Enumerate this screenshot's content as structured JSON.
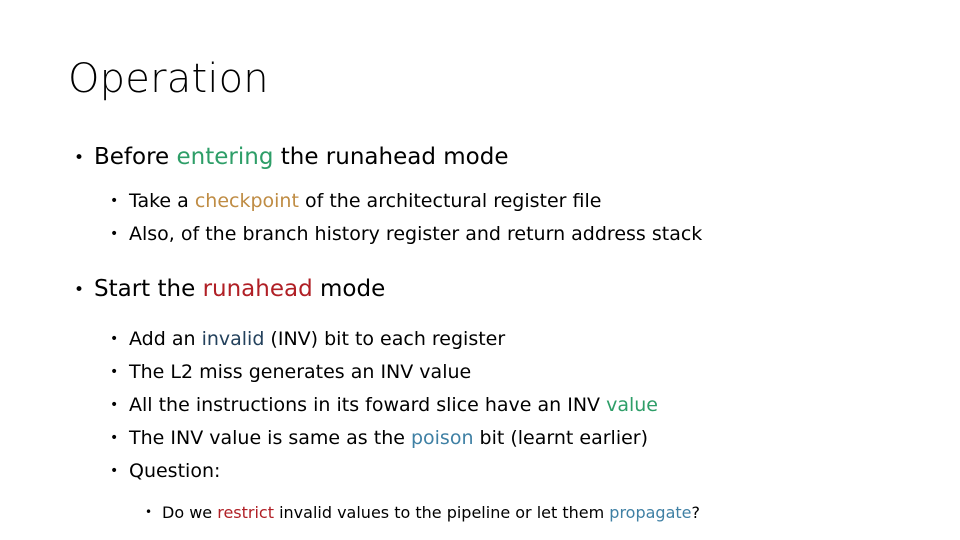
{
  "slide": {
    "title": "Operation",
    "bullet_glyph": "•",
    "colors": {
      "green": "#2e9e68",
      "tan": "#bf8c44",
      "red": "#b01f25",
      "navy": "#23415c",
      "blue": "#3f80a4",
      "text": "#000000",
      "background": "#ffffff"
    },
    "content": {
      "l1_before": {
        "part1": "Before ",
        "highlight": "entering",
        "part2": " the runahead mode"
      },
      "l2_take": {
        "part1": "Take a ",
        "highlight": "checkpoint",
        "part2": " of the architectural register file"
      },
      "l2_also": {
        "text": "Also, of the branch history register and return address stack"
      },
      "l1_start": {
        "part1": "Start the ",
        "highlight": "runahead",
        "part2": " mode"
      },
      "l3_add": {
        "part1": "Add an ",
        "highlight": "invalid",
        "part2": " (INV) bit to each register"
      },
      "l3_l2miss": {
        "text": "The L2 miss generates an INV value"
      },
      "l3_forward": {
        "part1": "All the instructions in its foward slice have an INV ",
        "highlight": "value"
      },
      "l3_poison": {
        "part1": "The INV value is same as the ",
        "highlight": "poison",
        "part2": " bit (learnt earlier)"
      },
      "l3_question": {
        "text": "Question:"
      },
      "l4_restrict": {
        "part1": "Do we ",
        "highlight1": "restrict",
        "part2": " invalid values to the pipeline or let them ",
        "highlight2": "propagate",
        "part3": "?"
      }
    }
  }
}
